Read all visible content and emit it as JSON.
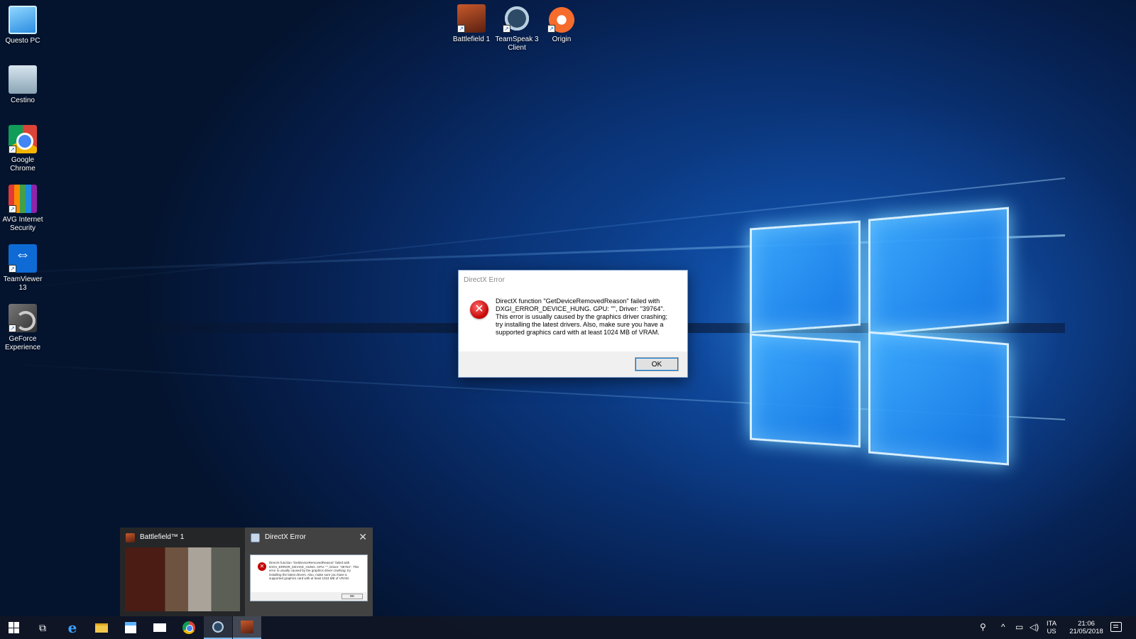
{
  "desktop": {
    "left_icons": [
      {
        "label": "Questo PC",
        "icon": "computer-icon"
      },
      {
        "label": "Cestino",
        "icon": "recycle-bin-icon"
      },
      {
        "label": "Google Chrome",
        "icon": "chrome-icon"
      },
      {
        "label": "AVG Internet Security",
        "icon": "avg-icon"
      },
      {
        "label": "TeamViewer 13",
        "icon": "teamviewer-icon"
      },
      {
        "label": "GeForce Experience",
        "icon": "geforce-icon"
      }
    ],
    "top_icons": [
      {
        "label": "Battlefield 1",
        "icon": "battlefield-icon"
      },
      {
        "label": "TeamSpeak 3 Client",
        "icon": "teamspeak-icon"
      },
      {
        "label": "Origin",
        "icon": "origin-icon"
      }
    ]
  },
  "dialog": {
    "title": "DirectX Error",
    "message": "DirectX function \"GetDeviceRemovedReason\" failed with DXGI_ERROR_DEVICE_HUNG. GPU: \"\", Driver: \"39764\". This error is usually caused by the graphics driver crashing; try installing the latest drivers. Also, make sure you have a supported graphics card with at least 1024 MB of VRAM.",
    "ok_label": "OK",
    "icon": "error-icon"
  },
  "thumbnails": [
    {
      "title": "Battlefield™ 1"
    },
    {
      "title": "DirectX Error",
      "close": "✕"
    }
  ],
  "taskbar": {
    "apps": [
      "start",
      "task-view",
      "edge",
      "file-explorer",
      "store",
      "mail",
      "chrome",
      "teamspeak",
      "battlefield"
    ],
    "lang_line1": "ITA",
    "lang_line2": "US",
    "time": "21:06",
    "date": "21/05/2018"
  },
  "colors": {
    "accent": "#0078d7",
    "taskbar_bg": "#10161f",
    "error_red": "#c40000"
  }
}
